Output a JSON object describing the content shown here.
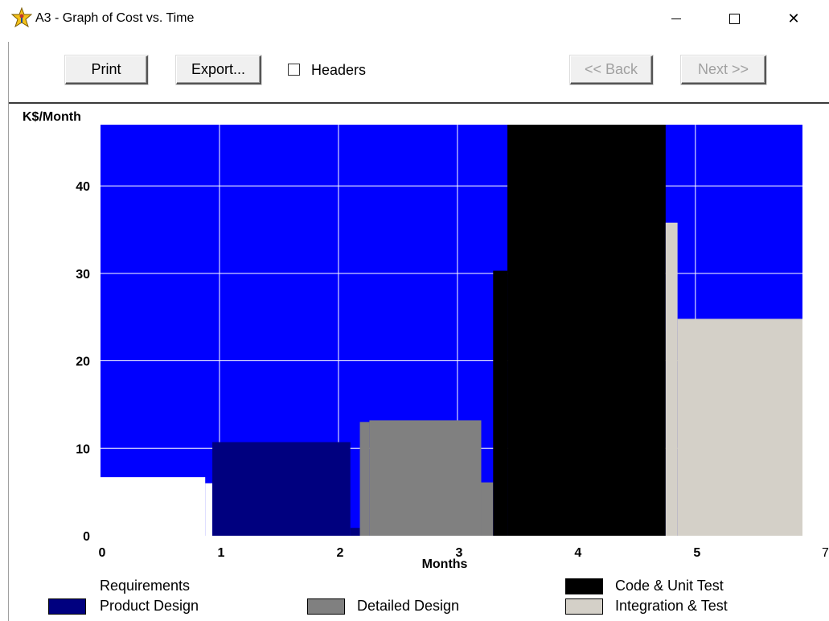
{
  "window": {
    "title": "A3 - Graph of Cost vs. Time",
    "app_icon": "star-person-icon",
    "minimize_icon": "minimize-icon",
    "maximize_icon": "maximize-icon",
    "close_glyph": "✕"
  },
  "toolbar": {
    "print_label": "Print",
    "export_label": "Export...",
    "headers_label": "Headers",
    "headers_checked": false,
    "back_label": "<< Back",
    "next_label": "Next >>"
  },
  "colors": {
    "background": "#0000ff",
    "requirements": "#ffffff",
    "product_design": "#00007f",
    "detailed_design": "#808080",
    "code_unit_test": "#000000",
    "integration_test": "#d4d0c8",
    "grid": "#ffffff"
  },
  "stray_label": "7",
  "chart_data": {
    "type": "area",
    "title": "",
    "ylabel": "K$/Month",
    "xlabel": "Months",
    "xlim": [
      0,
      5.9
    ],
    "ylim": [
      0,
      47
    ],
    "x_ticks": [
      "0",
      "1",
      "2",
      "3",
      "4",
      "5"
    ],
    "y_ticks": [
      "0",
      "10",
      "20",
      "30",
      "40"
    ],
    "grid": true,
    "legend_position": "bottom",
    "series": [
      {
        "name": "Requirements",
        "color_key": "requirements",
        "segments": [
          [
            0,
            0.88,
            6.7
          ],
          [
            0.88,
            0.94,
            6.0
          ]
        ]
      },
      {
        "name": "Product Design",
        "color_key": "product_design",
        "segments": [
          [
            0.94,
            2.1,
            10.7
          ],
          [
            2.1,
            2.18,
            0.9
          ]
        ]
      },
      {
        "name": "Detailed Design",
        "color_key": "detailed_design",
        "segments": [
          [
            2.18,
            2.26,
            13.0
          ],
          [
            2.26,
            3.2,
            13.2
          ],
          [
            3.2,
            3.3,
            6.1
          ]
        ]
      },
      {
        "name": "Code & Unit Test",
        "color_key": "code_unit_test",
        "segments": [
          [
            3.3,
            3.42,
            30.3
          ],
          [
            3.42,
            4.75,
            47.0
          ],
          [
            4.75,
            4.85,
            23.4
          ]
        ]
      },
      {
        "name": "Integration & Test",
        "color_key": "integration_test",
        "segments": [
          [
            4.75,
            4.85,
            35.8
          ],
          [
            4.85,
            5.9,
            24.8
          ]
        ]
      }
    ],
    "legend": [
      {
        "name": "Requirements",
        "color_key": "requirements"
      },
      {
        "name": "Product Design",
        "color_key": "product_design"
      },
      {
        "name": "Detailed Design",
        "color_key": "detailed_design"
      },
      {
        "name": "Code & Unit Test",
        "color_key": "code_unit_test"
      },
      {
        "name": "Integration & Test",
        "color_key": "integration_test"
      }
    ]
  }
}
